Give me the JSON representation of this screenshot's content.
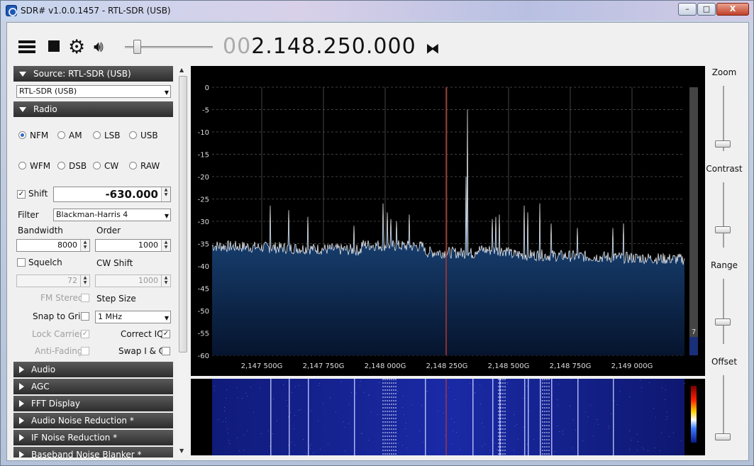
{
  "window": {
    "title": "SDR# v1.0.0.1457 - RTL-SDR (USB)",
    "min": "–",
    "max": "□",
    "close": "X"
  },
  "toolbar": {
    "freq_dim": "00",
    "freq_main": "2.148.250.000",
    "volume": 0.1
  },
  "source": {
    "header": "Source: RTL-SDR (USB)",
    "device": "RTL-SDR (USB)"
  },
  "radio": {
    "header": "Radio",
    "modes": [
      {
        "label": "NFM",
        "selected": true
      },
      {
        "label": "AM",
        "selected": false
      },
      {
        "label": "LSB",
        "selected": false
      },
      {
        "label": "USB",
        "selected": false
      },
      {
        "label": "WFM",
        "selected": false
      },
      {
        "label": "DSB",
        "selected": false
      },
      {
        "label": "CW",
        "selected": false
      },
      {
        "label": "RAW",
        "selected": false
      }
    ],
    "shift_label": "Shift",
    "shift_value": "-630.000",
    "filter_label": "Filter",
    "filter_value": "Blackman-Harris 4",
    "bandwidth_label": "Bandwidth",
    "bandwidth_value": "8000",
    "order_label": "Order",
    "order_value": "1000",
    "squelch_label": "Squelch",
    "squelch_value": "72",
    "cwshift_label": "CW Shift",
    "cwshift_value": "1000",
    "fmstereo_label": "FM Stereo",
    "stepsize_label": "Step Size",
    "snap_label": "Snap to Grid",
    "step_value": "1 MHz",
    "lockcarrier_label": "Lock Carrier",
    "correctiq_label": "Correct IQ",
    "antifading_label": "Anti-Fading",
    "swapiq_label": "Swap I & Q"
  },
  "panels": [
    "Audio",
    "AGC",
    "FFT Display",
    "Audio Noise Reduction *",
    "IF Noise Reduction *",
    "Baseband Noise Blanker *"
  ],
  "right": {
    "zoom": "Zoom",
    "contrast": "Contrast",
    "range": "Range",
    "offset": "Offset",
    "zoom_level": 0.1,
    "contrast_level": 0.28,
    "range_level": 0.35,
    "offset_level": 0.05
  },
  "chart_data": {
    "type": "area",
    "ylim": [
      -60,
      0
    ],
    "yticks": [
      "0",
      "-5",
      "-10",
      "-15",
      "-20",
      "-25",
      "-30",
      "-35",
      "-40",
      "-45",
      "-50",
      "-55",
      "-60"
    ],
    "xticks": [
      "2,147 500G",
      "2,147 750G",
      "2,148 000G",
      "2,148 250G",
      "2,148 500G",
      "2,148 750G",
      "2,149 000G"
    ],
    "center_label": "2,148 250G",
    "noise_floor_start": -35.5,
    "noise_floor_end": -38.5,
    "peaks_db": [
      -26.5,
      -27.5,
      -29,
      -31,
      -26,
      -28,
      -29.5,
      -30,
      -28.5,
      -5,
      -20,
      -29.5,
      -29,
      -28.5,
      -26.5,
      -28,
      -26,
      -30.5,
      -31.5,
      -30.5,
      -31.5
    ],
    "level_meter": "7"
  },
  "colors": {
    "accent": "#1e5fa8",
    "fill_top": "#2a6db5",
    "marker": "#c0392b"
  }
}
